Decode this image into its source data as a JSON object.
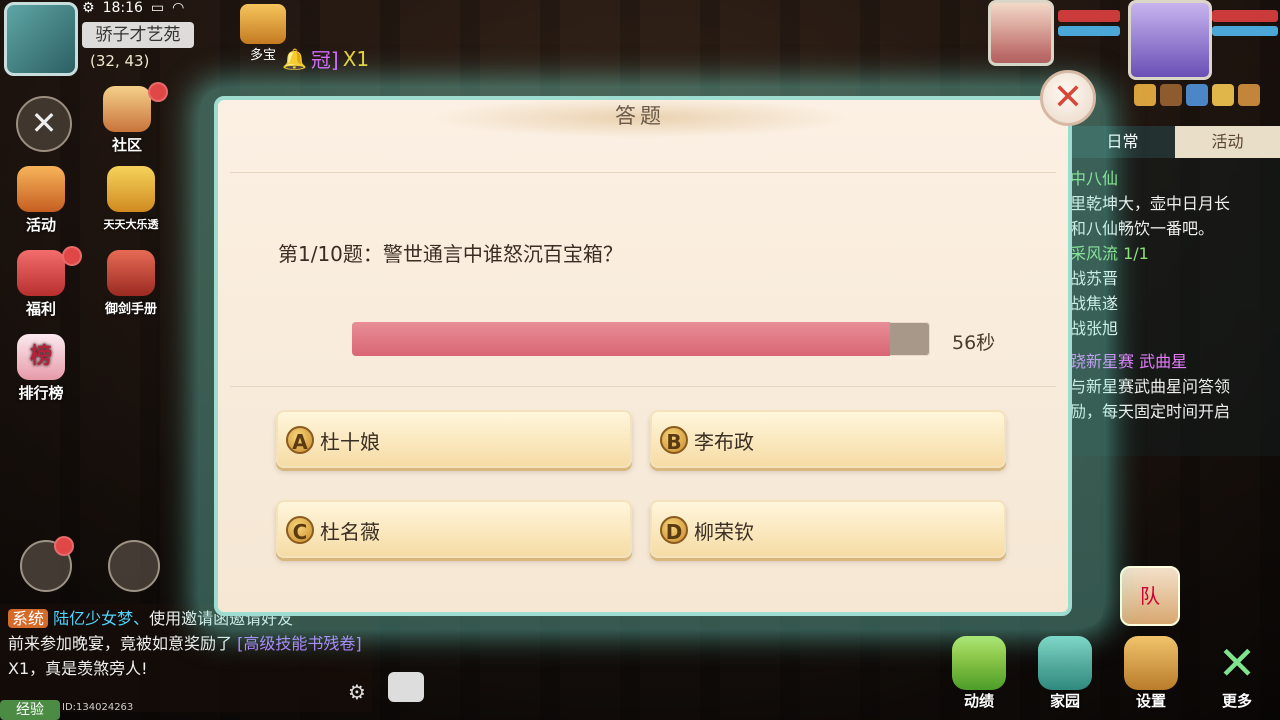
{
  "status": {
    "time": "18:16"
  },
  "location": {
    "name": "骄子才艺苑",
    "coords": "(32, 43)"
  },
  "top_icons": {
    "duobao": "多宝"
  },
  "broadcast": {
    "crown": "冠]",
    "count": "X1"
  },
  "left_menu": [
    "社区",
    "活动",
    "天天大乐透",
    "福利",
    "御剑手册",
    "排行榜"
  ],
  "quest_panel": {
    "tabs": [
      "日常",
      "活动"
    ],
    "lines": [
      {
        "text": "中八仙",
        "color": "green"
      },
      {
        "text": "里乾坤大，壶中日月长",
        "color": "white"
      },
      {
        "text": "和八仙畅饮一番吧。",
        "color": "white"
      },
      {
        "text": "采风流 1/1",
        "color": "green"
      },
      {
        "text": "战苏晋",
        "color": "white"
      },
      {
        "text": "战焦遂",
        "color": "white"
      },
      {
        "text": "战张旭",
        "color": "white"
      },
      {
        "text": "跷新星赛 武曲星",
        "color": "purple"
      },
      {
        "text": "与新星赛武曲星问答领",
        "color": "white"
      },
      {
        "text": "励，每天固定时间开启",
        "color": "white"
      }
    ]
  },
  "chat": {
    "system_tag": "系统",
    "player": "陆亿少女梦、",
    "line1_rest": "使用邀请函邀请好友",
    "line2": "前来参加晚宴，竟被如意奖励了",
    "item": "[高级技能书残卷]",
    "line3_rest": "X1，真是羡煞旁人!",
    "exp_label": "经验",
    "player_id": "ID:134024263"
  },
  "bottom_menu": [
    "动绩",
    "家园",
    "设置",
    "更多"
  ],
  "team_label": "队",
  "quiz": {
    "title": "答题",
    "question": "第1/10题：警世通言中谁怒沉百宝箱？",
    "time_left": "56秒",
    "time_fraction": 0.93,
    "options": [
      {
        "letter": "A",
        "text": "杜十娘"
      },
      {
        "letter": "B",
        "text": "李布政"
      },
      {
        "letter": "C",
        "text": "杜名薇"
      },
      {
        "letter": "D",
        "text": "柳荣钦"
      }
    ],
    "close": "✕"
  },
  "colors": {
    "accent": "#9fdcd0",
    "timer": "#d96675",
    "close": "#d84638"
  }
}
